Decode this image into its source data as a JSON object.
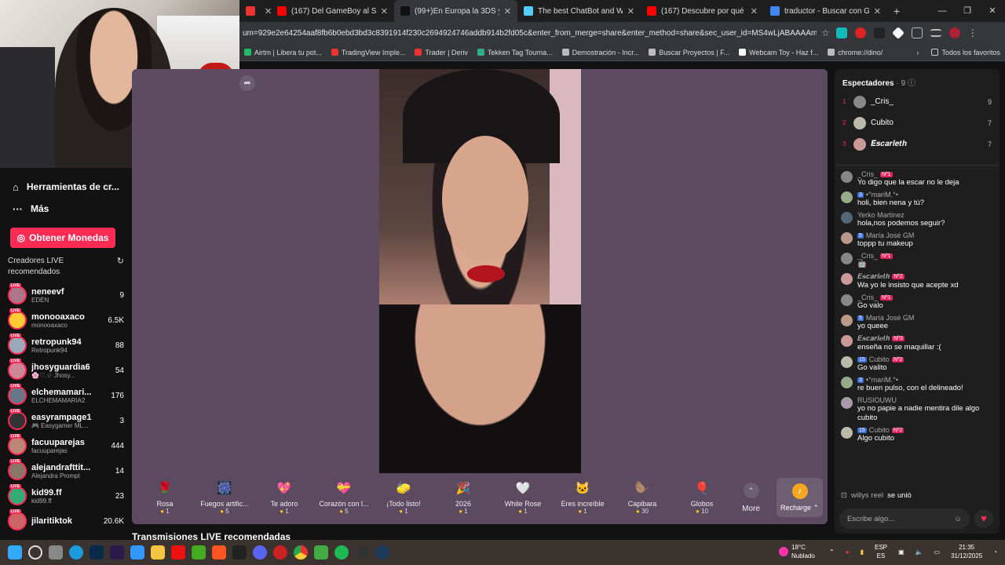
{
  "browser": {
    "tabs": [
      {
        "label": "",
        "fav": "#e33",
        "active": false
      },
      {
        "label": "(167) Del GameBoy al Switch: L",
        "fav": "#f00",
        "active": false
      },
      {
        "label": "(99+)En Europa la 3DS ya vale",
        "fav": "#111",
        "active": true
      },
      {
        "label": "The best ChatBot and Widgets",
        "fav": "#5cf",
        "active": false
      },
      {
        "label": "(167) Descubre por qué la Ninte",
        "fav": "#f00",
        "active": false
      },
      {
        "label": "traductor - Buscar con Google",
        "fav": "#4285f4",
        "active": false
      }
    ],
    "new_tab": "+",
    "url": "um=929e2e64254aaf8fb6b0ebd3bd3c8391914f230c2694924746addb914b2fd05c&enter_from_merge=share&enter_method=share&sec_user_id=MS4wLjABAAAAmqRN1Wqw7...",
    "bookmarks": [
      {
        "label": "Airtm | Libera tu pot...",
        "color": "#2b6"
      },
      {
        "label": "TradingView Imple...",
        "color": "#e33"
      },
      {
        "label": "Trader | Deriv",
        "color": "#e33"
      },
      {
        "label": "Tekken Tag Tourna...",
        "color": "#3a8"
      },
      {
        "label": "Demostración - Incr...",
        "color": "#bbb"
      },
      {
        "label": "Buscar Proyectos | F...",
        "color": "#bbb"
      },
      {
        "label": "Webcam Toy - Haz f...",
        "color": "#fff"
      },
      {
        "label": "chrome://dino/",
        "color": "#bbb"
      }
    ],
    "all_favs": "Todos los favoritos"
  },
  "sidebar": {
    "items": [
      {
        "label": "Herramientas de cr...",
        "icon": "home-icon"
      },
      {
        "label": "Más",
        "icon": "more-icon"
      }
    ],
    "coins_button": "Obtener Monedas",
    "section_title": "Creadores LIVE recomendados",
    "live_badge": "LIVE",
    "creators": [
      {
        "name": "neneevf",
        "sub": "EDÉN",
        "viewers": "9",
        "color": "#a78"
      },
      {
        "name": "monooaxaco",
        "sub": "monooaxaco",
        "viewers": "6.5K",
        "color": "#fc3"
      },
      {
        "name": "retropunk94",
        "sub": "Retropunk94",
        "viewers": "88",
        "color": "#9ab"
      },
      {
        "name": "jhosyguardia6",
        "sub": "🌸♡.☆ Jhosy...",
        "viewers": "54",
        "color": "#c89"
      },
      {
        "name": "elchemamari...",
        "sub": "ELCHEMAMARIA2",
        "viewers": "176",
        "color": "#678"
      },
      {
        "name": "easyrampage1",
        "sub": "🎮 Easygamer ML...",
        "viewers": "3",
        "color": "#333"
      },
      {
        "name": "facuuparejas",
        "sub": "facuuparejas",
        "viewers": "444",
        "color": "#b87"
      },
      {
        "name": "alejandrafttit...",
        "sub": "Alejandra Prompt",
        "viewers": "14",
        "color": "#876"
      },
      {
        "name": "kid99.ff",
        "sub": "kid99.ff",
        "viewers": "23",
        "color": "#3a7"
      },
      {
        "name": "jilaritiktok",
        "sub": "",
        "viewers": "20.6K",
        "color": "#c66"
      }
    ]
  },
  "stream": {
    "gifts": [
      {
        "name": "Rosa",
        "price": "1",
        "icon": "🌹"
      },
      {
        "name": "Fuegos artific...",
        "price": "5",
        "icon": "🎆"
      },
      {
        "name": "Te adoro",
        "price": "1",
        "icon": "💖"
      },
      {
        "name": "Corazón con l...",
        "price": "5",
        "icon": "💝"
      },
      {
        "name": "¡Todo listo!",
        "price": "1",
        "icon": "🧽"
      },
      {
        "name": "2026",
        "price": "1",
        "icon": "🎉"
      },
      {
        "name": "White Rose",
        "price": "1",
        "icon": "🤍"
      },
      {
        "name": "Eres increíble",
        "price": "1",
        "icon": "🐱"
      },
      {
        "name": "Capibara",
        "price": "30",
        "icon": "🦫"
      },
      {
        "name": "Globos",
        "price": "10",
        "icon": "🎈"
      }
    ],
    "more_label": "More",
    "recharge_label": "Recharge ⌃",
    "recommended_title": "Transmisiones LIVE recomendadas"
  },
  "chat": {
    "spectators_label": "Espectadores",
    "spectators_count": "· 9",
    "top": [
      {
        "rank": "1",
        "name": "_Cris_",
        "count": "9",
        "color": "#888"
      },
      {
        "rank": "2",
        "name": "Cubito",
        "count": "7",
        "color": "#bba"
      },
      {
        "rank": "3",
        "name": "𝑬𝒔𝒄𝒂𝒓𝒍𝒆𝒕𝒉",
        "count": "7",
        "color": "#c99"
      }
    ],
    "messages": [
      {
        "user": "_Cris_",
        "badges": [
          "Nº1"
        ],
        "text": "Yo digo que la escar no le deja",
        "color": "#888"
      },
      {
        "user": "•°mariM.°•",
        "badges": [
          "3"
        ],
        "text": "holi, bien nena y tú?",
        "color": "#9a8"
      },
      {
        "user": "Yerko Martinez",
        "badges": [],
        "text": "hola,nos podemos seguir?",
        "color": "#567"
      },
      {
        "user": "María José GM",
        "badges": [
          "5"
        ],
        "text": "toppp tu makeup",
        "color": "#b98"
      },
      {
        "user": "_Cris_",
        "badges": [
          "Nº1"
        ],
        "text": "🤖",
        "color": "#888"
      },
      {
        "user": "𝑬𝒔𝒄𝒂𝒓𝒍𝒆𝒕𝒉",
        "badges": [
          "Nº2"
        ],
        "text": "Wa yo le insisto que acepte xd",
        "color": "#c99"
      },
      {
        "user": "_Cris_",
        "badges": [
          "Nº1"
        ],
        "text": "Go valo",
        "color": "#888"
      },
      {
        "user": "María José GM",
        "badges": [
          "5"
        ],
        "text": "yo queee",
        "color": "#b98"
      },
      {
        "user": "𝑬𝒔𝒄𝒂𝒓𝒍𝒆𝒕𝒉",
        "badges": [
          "Nº3"
        ],
        "text": "enseña no se maquillar :(",
        "color": "#c99"
      },
      {
        "user": "Cubito",
        "badges": [
          "15",
          "Nº2"
        ],
        "text": "Go valito",
        "color": "#bba"
      },
      {
        "user": "•°mariM.°•",
        "badges": [
          "3"
        ],
        "text": "re buen pulso, con el delineado!",
        "color": "#9a8"
      },
      {
        "user": "RUSIOUWU",
        "badges": [],
        "text": "yo no papie a nadie mentira dile algo cubito",
        "color": "#a9a"
      },
      {
        "user": "Cubito",
        "badges": [
          "15",
          "Nº2"
        ],
        "text": "Algo cubito",
        "color": "#bba"
      }
    ],
    "joined_user": "willys reel",
    "joined_text": "se unió",
    "input_placeholder": "Escribe algo..."
  },
  "taskbar": {
    "weather_temp": "18°C",
    "weather_desc": "Nublado",
    "lang_top": "ESP",
    "lang_bottom": "ES",
    "time": "21:35",
    "date": "31/12/2025"
  }
}
